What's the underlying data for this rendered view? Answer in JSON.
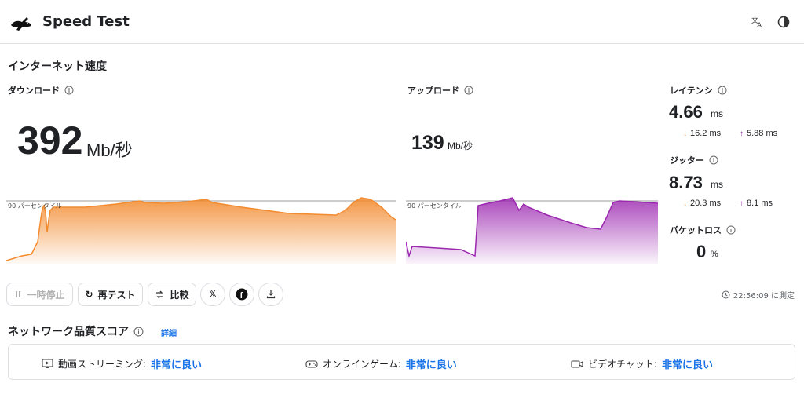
{
  "header": {
    "title": "Speed Test",
    "icons": [
      "rabbit-logo",
      "translate-icon",
      "contrast-icon"
    ]
  },
  "internet_speed": {
    "title": "インターネット速度",
    "download": {
      "label": "ダウンロード",
      "value": "392",
      "unit": "Mb/秒",
      "p90_label": "90 パーセンタイル"
    },
    "upload": {
      "label": "アップロード",
      "value": "139",
      "unit": "Mb/秒",
      "p90_label": "90 パーセンタイル"
    },
    "latency": {
      "label": "レイテンシ",
      "value": "4.66",
      "unit": "ms",
      "down": "16.2 ms",
      "up": "5.88 ms"
    },
    "jitter": {
      "label": "ジッター",
      "value": "8.73",
      "unit": "ms",
      "down": "20.3 ms",
      "up": "8.1 ms"
    },
    "packet_loss": {
      "label": "パケットロス",
      "value": "0",
      "unit": "%"
    }
  },
  "actions": {
    "pause": "一時停止",
    "retest": "再テスト",
    "compare": "比較",
    "measured_at": "22:56:09 に測定"
  },
  "quality": {
    "title": "ネットワーク品質スコア",
    "details_link": "詳細",
    "items": [
      {
        "label": "動画ストリーミング:",
        "value": "非常に良い",
        "icon": "video-icon"
      },
      {
        "label": "オンラインゲーム:",
        "value": "非常に良い",
        "icon": "gamepad-icon"
      },
      {
        "label": "ビデオチャット:",
        "value": "非常に良い",
        "icon": "camera-icon"
      }
    ]
  },
  "colors": {
    "download": "#f28b30",
    "upload": "#9c27b0",
    "link": "#1a73e8"
  }
}
